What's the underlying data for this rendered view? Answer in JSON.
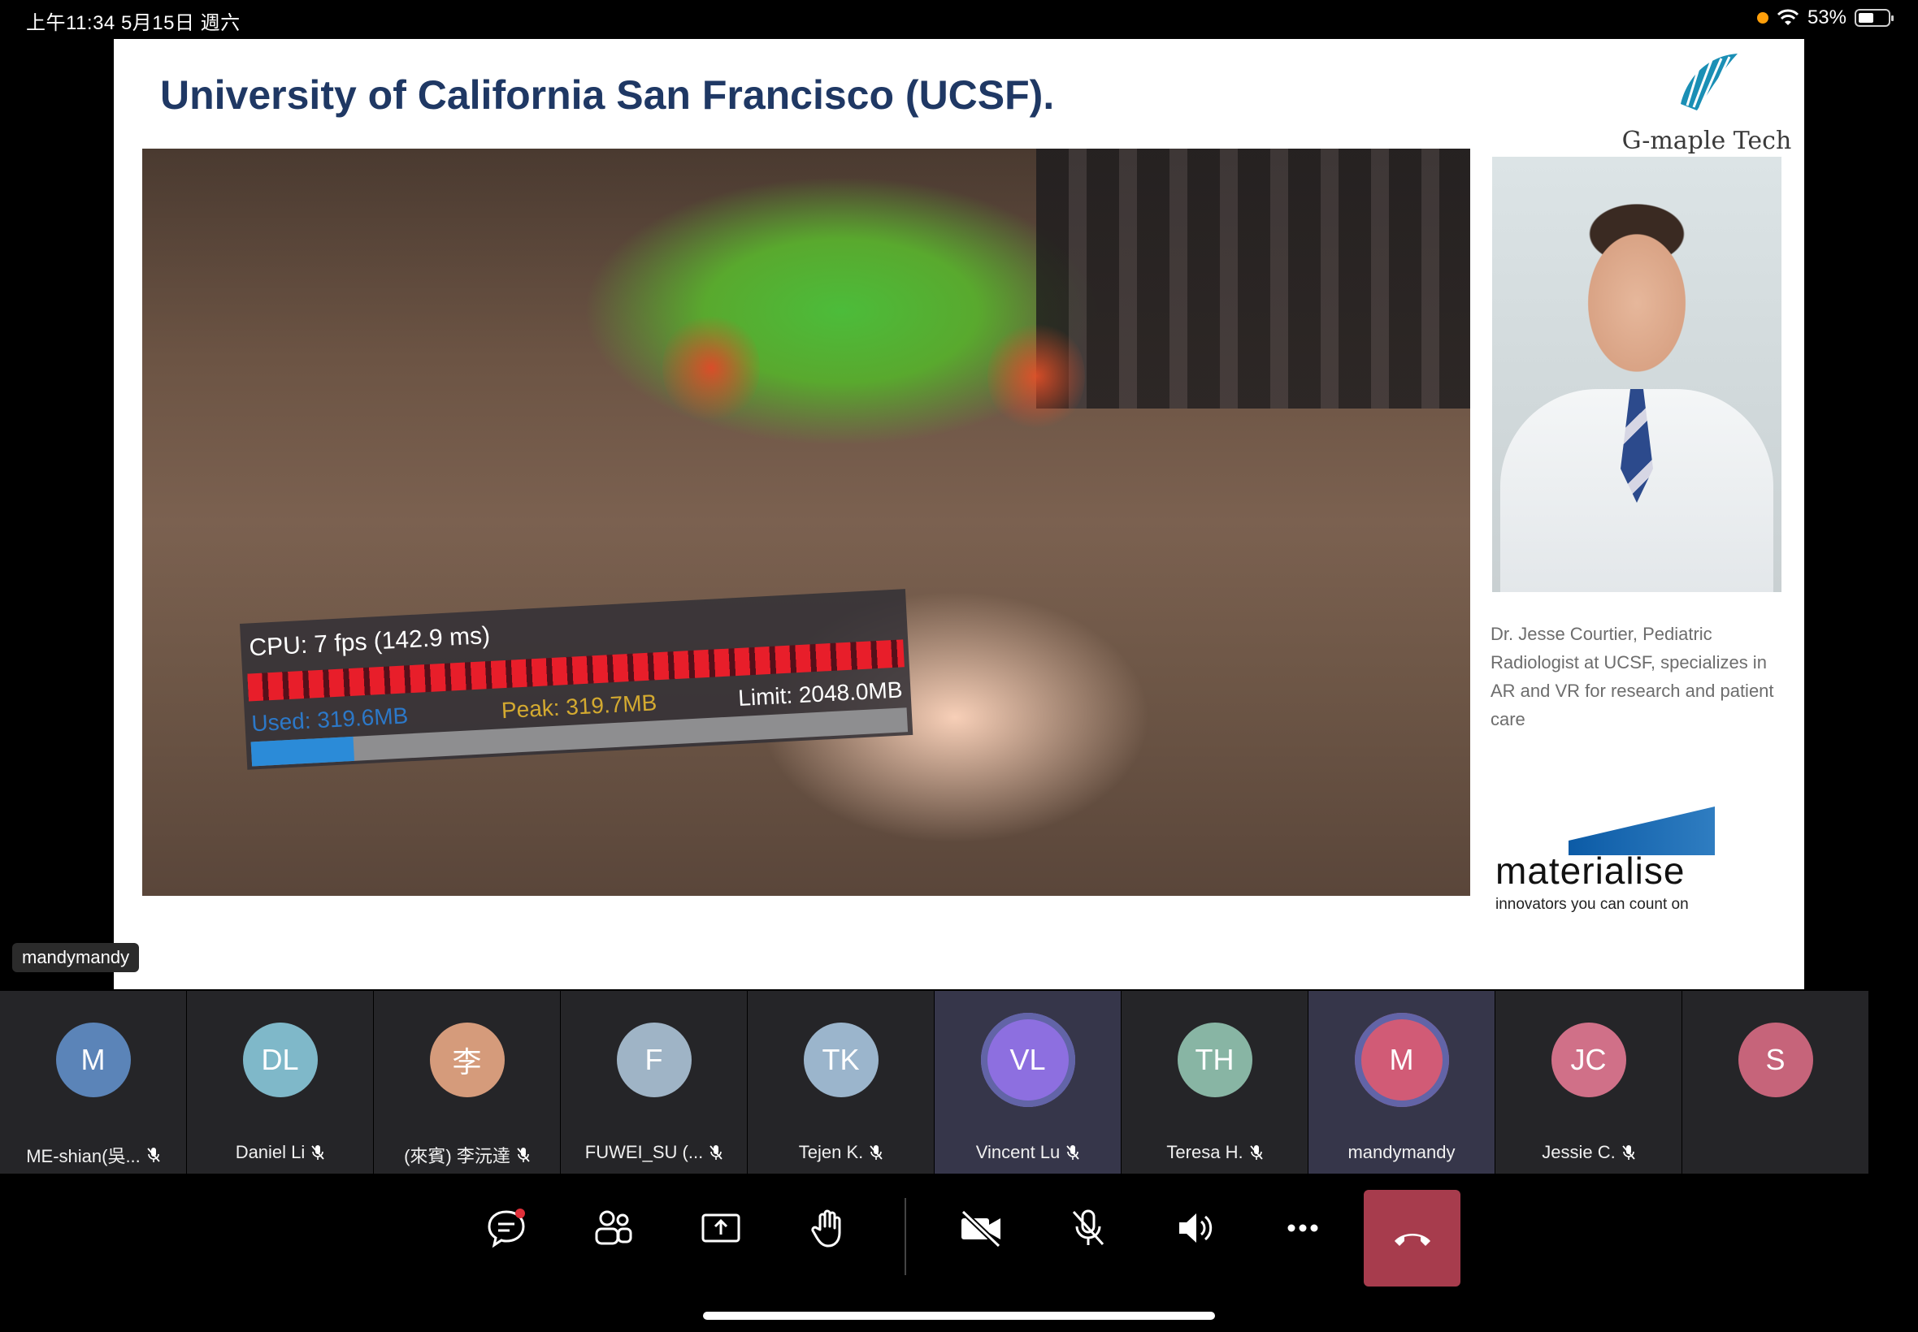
{
  "status_bar": {
    "time": "上午11:34   5月15日 週六",
    "battery": "53%",
    "battery_level": 0.53
  },
  "slide": {
    "title": "University of California San Francisco (UCSF).",
    "brand": "G-maple Tech",
    "perf": {
      "cpu": "CPU: 7 fps (142.9 ms)",
      "used": "Used: 319.6MB",
      "peak": "Peak: 319.7MB",
      "limit": "Limit: 2048.0MB",
      "memory_fraction": 0.156
    },
    "caption": "Dr. Jesse Courtier, Pediatric Radiologist at UCSF, specializes in AR and VR for research and patient care",
    "sponsor_name": "materialise",
    "sponsor_tagline": "innovators you can count on"
  },
  "presenter_tag": "mandymandy",
  "participants": [
    {
      "initials": "M",
      "name": "ME-shian(吳...",
      "color": "#5b84b8",
      "muted": true,
      "speaking": false
    },
    {
      "initials": "DL",
      "name": "Daniel Li",
      "color": "#7fb8c9",
      "muted": true,
      "speaking": false
    },
    {
      "initials": "李",
      "name": "(來賓) 李沅達",
      "color": "#d59b7b",
      "muted": true,
      "speaking": false
    },
    {
      "initials": "F",
      "name": "FUWEI_SU (...",
      "color": "#9fb4c6",
      "muted": true,
      "speaking": false
    },
    {
      "initials": "TK",
      "name": "Tejen K.",
      "color": "#9bb5cc",
      "muted": true,
      "speaking": false
    },
    {
      "initials": "VL",
      "name": "Vincent Lu",
      "color": "#8d6fe0",
      "muted": true,
      "speaking": true
    },
    {
      "initials": "TH",
      "name": "Teresa H.",
      "color": "#88b5a4",
      "muted": true,
      "speaking": false
    },
    {
      "initials": "M",
      "name": "mandymandy",
      "color": "#d15b76",
      "muted": false,
      "speaking": true
    },
    {
      "initials": "JC",
      "name": "Jessie C.",
      "color": "#d07088",
      "muted": true,
      "speaking": false
    },
    {
      "initials": "S",
      "name": "",
      "color": "#c6647a",
      "muted": false,
      "speaking": false
    }
  ],
  "toolbar": {
    "buttons": [
      "chat-icon",
      "people-icon",
      "share-screen-icon",
      "raise-hand-icon",
      "camera-off-icon",
      "mic-off-icon",
      "speaker-icon",
      "more-icon"
    ],
    "hangup_color": "#a73c4d"
  }
}
